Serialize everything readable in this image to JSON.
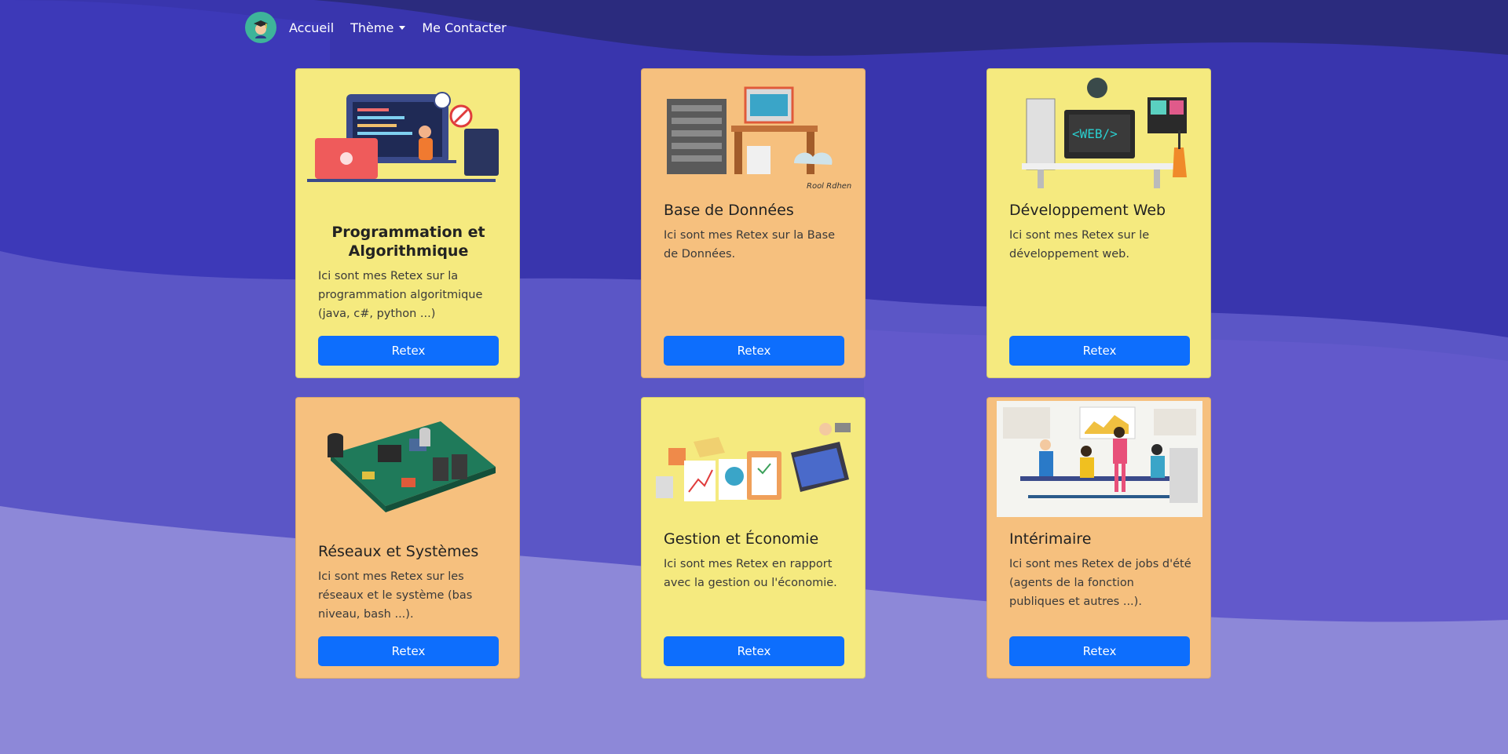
{
  "nav": {
    "items": [
      {
        "label": "Accueil"
      },
      {
        "label": "Thème"
      },
      {
        "label": "Me Contacter"
      }
    ]
  },
  "cards": [
    {
      "title": "Programmation et Algorithmique",
      "text": "Ici sont mes Retex sur la programmation algoritmique (java, c#, python ...)",
      "button": "Retex",
      "color": "#f5ea7f"
    },
    {
      "title": "Base de Données",
      "text": "Ici sont mes Retex sur la Base de Données.",
      "button": "Retex",
      "color": "#f6c07e",
      "signature": "Rool Rdhen"
    },
    {
      "title": "Développement Web",
      "text": "Ici sont mes Retex sur le développement web.",
      "button": "Retex",
      "color": "#f5ea7f",
      "screen_text": "<WEB/>"
    },
    {
      "title": "Réseaux et Systèmes",
      "text": "Ici sont mes Retex sur les réseaux et le système (bas niveau, bash ...).",
      "button": "Retex",
      "color": "#f6c07e"
    },
    {
      "title": "Gestion et Économie",
      "text": "Ici sont mes Retex en rapport avec la gestion ou l'économie.",
      "button": "Retex",
      "color": "#f5ea7f"
    },
    {
      "title": "Intérimaire",
      "text": "Ici sont mes Retex de jobs d'été (agents de la fonction publiques et autres ...).",
      "button": "Retex",
      "color": "#f6c07e"
    }
  ],
  "colors": {
    "background_dark": "#2b2b7e",
    "background_mid": "#3d37b5",
    "background_light": "#6b63cc",
    "background_lightest": "#8d88d8",
    "button": "#0d6efd",
    "card_yellow": "#f5ea7f",
    "card_orange": "#f6c07e"
  }
}
